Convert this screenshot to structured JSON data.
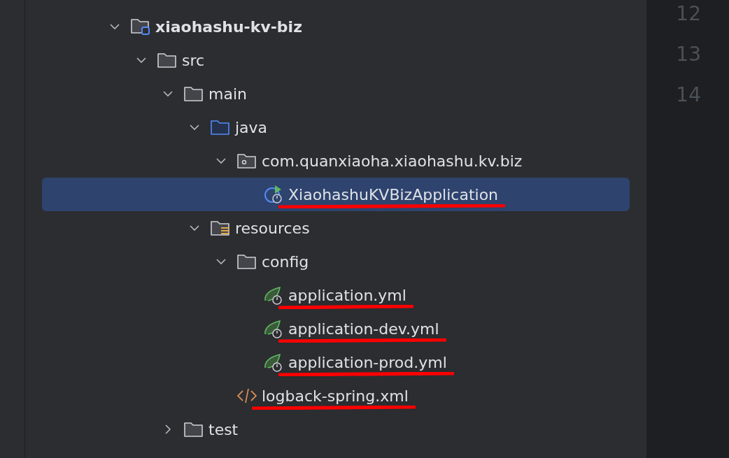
{
  "project_tree": [
    {
      "label": "xiaohashu-kv-biz",
      "kind": "module",
      "expanded": true,
      "selected": false,
      "underlined": false,
      "children": [
        {
          "label": "src",
          "kind": "folder",
          "expanded": true,
          "selected": false,
          "underlined": false,
          "children": [
            {
              "label": "main",
              "kind": "folder",
              "expanded": true,
              "selected": false,
              "underlined": false,
              "children": [
                {
                  "label": "java",
                  "kind": "source-folder",
                  "expanded": true,
                  "selected": false,
                  "underlined": false,
                  "children": [
                    {
                      "label": "com.quanxiaoha.xiaohashu.kv.biz",
                      "kind": "package",
                      "expanded": true,
                      "selected": false,
                      "underlined": false,
                      "children": [
                        {
                          "label": "XiaohashuKVBizApplication",
                          "kind": "spring-class",
                          "selected": true,
                          "underlined": true
                        }
                      ]
                    }
                  ]
                },
                {
                  "label": "resources",
                  "kind": "resource-folder",
                  "expanded": true,
                  "selected": false,
                  "underlined": false,
                  "children": [
                    {
                      "label": "config",
                      "kind": "folder",
                      "expanded": true,
                      "selected": false,
                      "underlined": false,
                      "children": [
                        {
                          "label": "application.yml",
                          "kind": "spring-config",
                          "selected": false,
                          "underlined": true
                        },
                        {
                          "label": "application-dev.yml",
                          "kind": "spring-config",
                          "selected": false,
                          "underlined": true
                        },
                        {
                          "label": "application-prod.yml",
                          "kind": "spring-config",
                          "selected": false,
                          "underlined": true
                        }
                      ]
                    },
                    {
                      "label": "logback-spring.xml",
                      "kind": "xml",
                      "selected": false,
                      "underlined": true
                    }
                  ]
                }
              ]
            },
            {
              "label": "test",
              "kind": "folder",
              "expanded": false,
              "selected": false,
              "underlined": false
            }
          ]
        }
      ]
    }
  ],
  "line_numbers": [
    "12",
    "13",
    "14"
  ]
}
